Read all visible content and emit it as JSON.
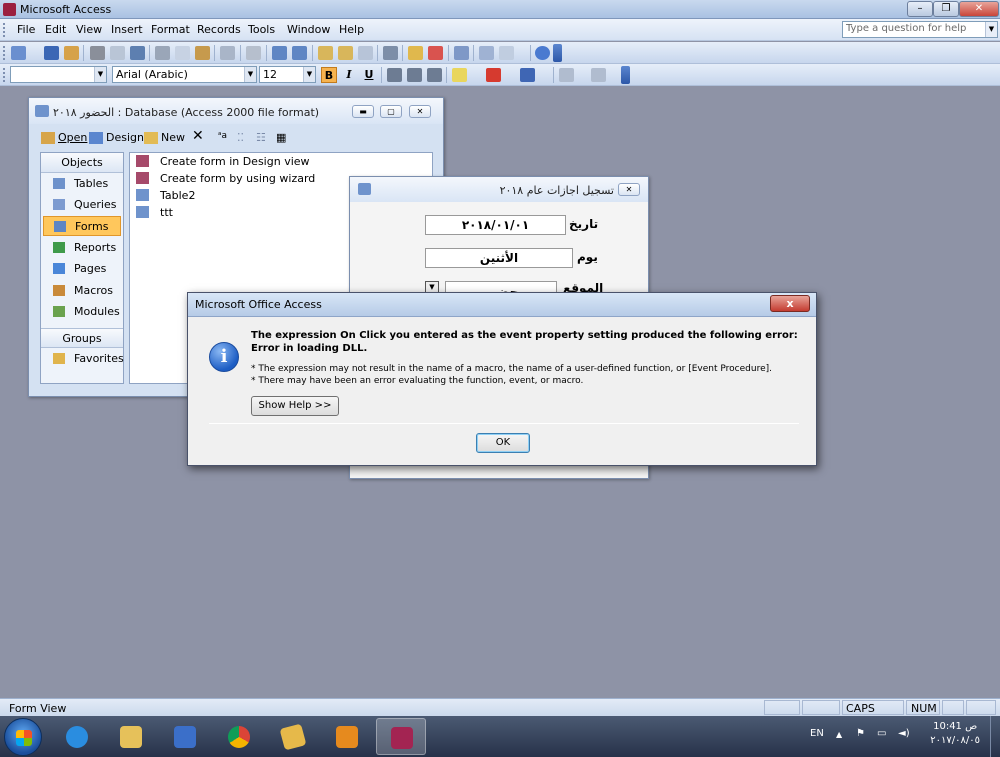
{
  "app": {
    "title": "Microsoft Access",
    "help_placeholder": "Type a question for help"
  },
  "menu": [
    "File",
    "Edit",
    "View",
    "Insert",
    "Format",
    "Records",
    "Tools",
    "Window",
    "Help"
  ],
  "format_toolbar": {
    "font": "Arial (Arabic)",
    "size": "12",
    "bold": "B",
    "italic": "I",
    "underline": "U"
  },
  "db_window": {
    "title": "الحضور ٢٠١٨ : Database (Access 2000 file format)",
    "toolbar": {
      "open": "Open",
      "design": "Design",
      "new": "New"
    },
    "objects_header": "Objects",
    "objects": [
      "Tables",
      "Queries",
      "Forms",
      "Reports",
      "Pages",
      "Macros",
      "Modules"
    ],
    "selected_object": "Forms",
    "groups_header": "Groups",
    "groups": [
      "Favorites"
    ],
    "list": [
      "Create form in Design view",
      "Create form by using wizard",
      "Table2",
      "ttt"
    ]
  },
  "form_window": {
    "title": "تسجيل اجازات عام ٢٠١٨",
    "date_label": "تاريخ",
    "date_value": "٢٠١٨/٠١/٠١",
    "day_label": "يوم",
    "day_value": "الأثنين",
    "location_label": "الموقع",
    "location_value": "حضور"
  },
  "dialog": {
    "title": "Microsoft Office Access",
    "close": "x",
    "message": "The expression On Click you entered as the event property setting produced the following error: Error in loading DLL.",
    "detail_1": "* The expression may not result in the name of a macro, the name of a user-defined function, or [Event Procedure].",
    "detail_2": "* There may have been an error evaluating the function, event, or macro.",
    "help_button": "Show Help >>",
    "ok_button": "OK"
  },
  "status": {
    "mode": "Form View",
    "caps": "CAPS",
    "num": "NUM"
  },
  "taskbar": {
    "lang": "EN",
    "time": "10:41 ص",
    "date": "٢٠١٧/٠٨/٠٥"
  },
  "colors": {
    "selected_object": "#ffc75c",
    "dialog_close": "#c43b30",
    "info_icon": "#1d5dc4"
  }
}
